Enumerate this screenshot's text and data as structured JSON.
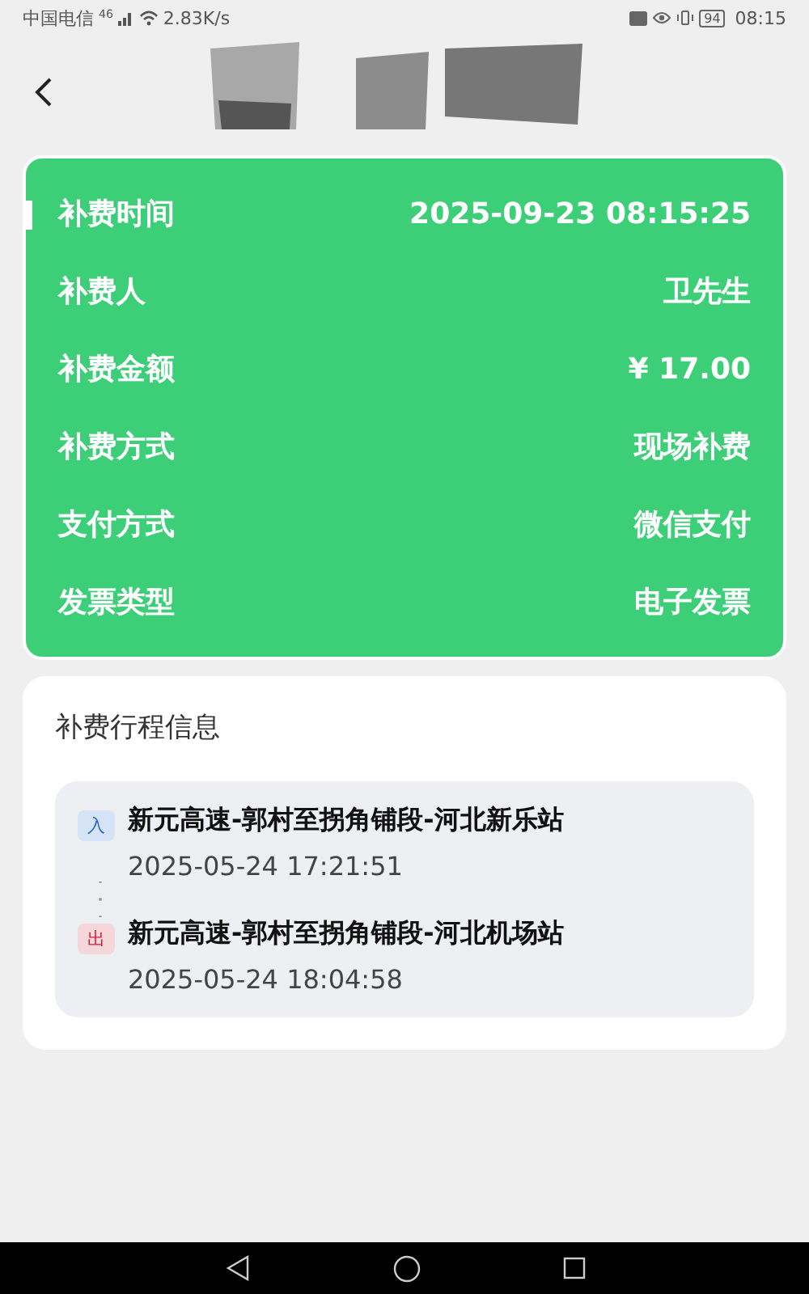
{
  "status_bar": {
    "carrier": "中国电信",
    "network": "46",
    "speed": "2.83K/s",
    "battery": "94",
    "time": "08:15"
  },
  "details": [
    {
      "label": "补费时间",
      "value": "2025-09-23 08:15:25",
      "selected": true
    },
    {
      "label": "补费人",
      "value": "卫先生",
      "selected": false
    },
    {
      "label": "补费金额",
      "value": "¥ 17.00",
      "selected": false
    },
    {
      "label": "补费方式",
      "value": "现场补费",
      "selected": false
    },
    {
      "label": "支付方式",
      "value": "微信支付",
      "selected": false
    },
    {
      "label": "发票类型",
      "value": "电子发票",
      "selected": false
    }
  ],
  "trip": {
    "title": "补费行程信息",
    "stops": [
      {
        "kind": "entry",
        "badge": "入",
        "station": "新元高速-郭村至拐角铺段-河北新乐站",
        "time": "2025-05-24 17:21:51"
      },
      {
        "kind": "exit",
        "badge": "出",
        "station": "新元高速-郭村至拐角铺段-河北机场站",
        "time": "2025-05-24 18:04:58"
      }
    ]
  }
}
